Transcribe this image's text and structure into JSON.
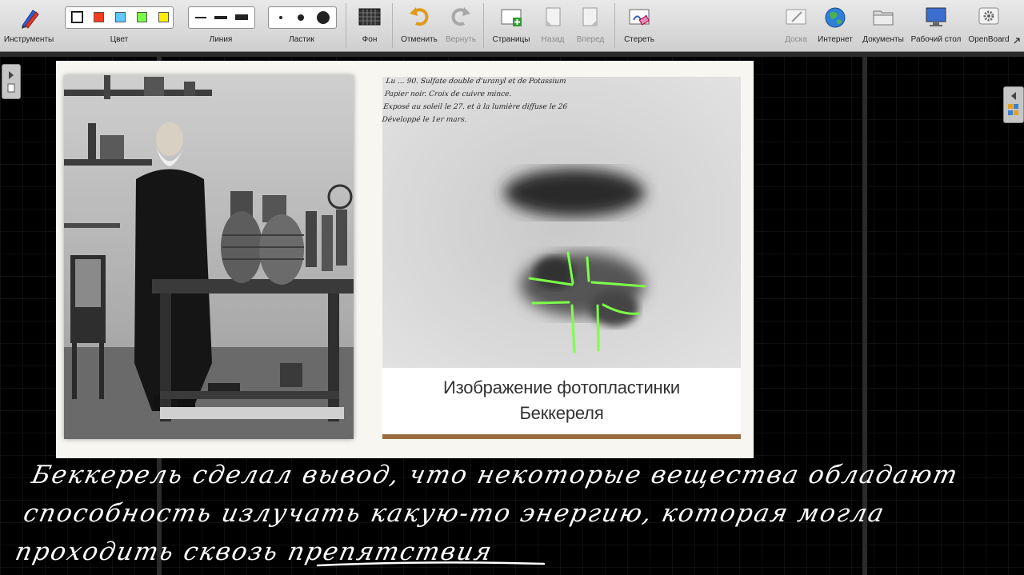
{
  "toolbar": {
    "tools_label": "Инструменты",
    "color_label": "Цвет",
    "line_label": "Линия",
    "eraser_label": "Ластик",
    "background_label": "Фон",
    "undo_label": "Отменить",
    "redo_label": "Вернуть",
    "pages_label": "Страницы",
    "back_label": "Назад",
    "forward_label": "Вперед",
    "erase_label": "Стереть",
    "board_label": "Доска",
    "internet_label": "Интернет",
    "documents_label": "Документы",
    "desktop_label": "Рабочий стол",
    "openboard_label": "OpenBoard",
    "colors": [
      "#ffffff",
      "#ff3b1f",
      "#5ec8ff",
      "#7dff4a",
      "#ffee00"
    ]
  },
  "slide": {
    "caption_line1": "Изображение фотопластинки",
    "caption_line2": "Беккереля",
    "plate_note_line1": "Lu ... 90.  Sulfate double d'uranyl et de Potassium",
    "plate_note_line2": "Papier noir.  Croix de cuivre mince.",
    "plate_note_line3": "Exposé au soleil le 27.  et à la lumière diffuse le 26",
    "plate_note_line4": "Développé le 1er mars."
  },
  "handwriting": {
    "line1": "Беккерель сделал вывод, что некоторые вещества обладают",
    "line2": "способность излучать какую-то энергию, которая могла",
    "line3": "проходить сквозь препятствия"
  },
  "colors": {
    "toolbar_bg": "#d9d9d9",
    "board_bg": "#000000",
    "ink": "#ffffff",
    "annotation": "#7dff4a",
    "caption_bar": "#9a6c3e"
  }
}
